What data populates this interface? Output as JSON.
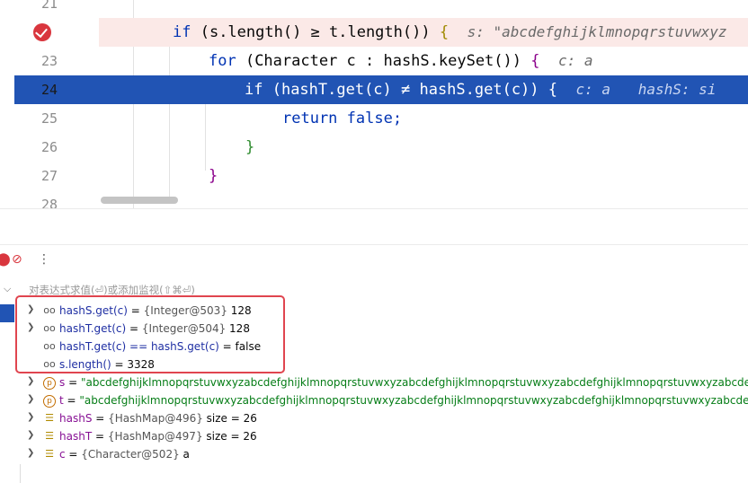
{
  "editor": {
    "line_numbers": [
      "21",
      "",
      "23",
      "24",
      "25",
      "26",
      "27",
      "28"
    ],
    "lines": [
      {
        "id": "l22",
        "kw": "if",
        "code": " (s.length() ≥ t.length()) ",
        "brace": "{",
        "hint": "s: \"abcdefghijklmnopqrstuvwxyz"
      },
      {
        "id": "l23",
        "kw": "for",
        "code": " (Character c : hashS.keySet()) ",
        "brace": "{",
        "hint": "c: a"
      },
      {
        "id": "l24",
        "kw": "if",
        "code": " (hashT.get(c) ≠ hashS.get(c)) {",
        "hint1": "c: a",
        "hint2": "hashS: si"
      },
      {
        "id": "l25",
        "kw": "return",
        "code": " false;"
      },
      {
        "id": "l26",
        "brace": "}"
      },
      {
        "id": "l27",
        "brace": "}"
      }
    ]
  },
  "toolbar": {
    "icons": [
      "breakpoint-icon",
      "mute-breakpoints-icon",
      "more-options-icon"
    ],
    "mute_glyph": "⊘",
    "more_glyph": "⋮"
  },
  "evaluate": {
    "placeholder": "对表达式求值(⏎)或添加监视(⇧⌘⏎)"
  },
  "variables": [
    {
      "kind": "watch",
      "expandable": true,
      "name": "hashS.get(c)",
      "eq": " = ",
      "type": "{Integer@503}",
      "value": " 128"
    },
    {
      "kind": "watch",
      "expandable": true,
      "name": "hashT.get(c)",
      "eq": " = ",
      "type": "{Integer@504}",
      "value": " 128"
    },
    {
      "kind": "watch",
      "expandable": false,
      "name": "hashT.get(c) == hashS.get(c)",
      "eq": " = ",
      "type": "",
      "value": "false"
    },
    {
      "kind": "watch",
      "expandable": false,
      "name": "s.length()",
      "eq": " = ",
      "type": "",
      "value": "3328"
    },
    {
      "kind": "param",
      "expandable": true,
      "name": "s",
      "eq": " = ",
      "type": "",
      "value": "\"abcdefghijklmnopqrstuvwxyzabcdefghijklmnopqrstuvwxyzabcdefghijklmnopqrstuvwxyzabcdefghijklmnopqrstuvwxyzabcdefghijklmnopqrstuvwxyzal"
    },
    {
      "kind": "param",
      "expandable": true,
      "name": "t",
      "eq": " = ",
      "type": "",
      "value": "\"abcdefghijklmnopqrstuvwxyzabcdefghijklmnopqrstuvwxyzabcdefghijklmnopqrstuvwxyzabcdefghijklmnopqrstuvwxyzabcdefghijklmnopqrstuvwxyzab"
    },
    {
      "kind": "field",
      "expandable": true,
      "name": "hashS",
      "eq": " = ",
      "type": "{HashMap@496}",
      "value": "  size = 26"
    },
    {
      "kind": "field",
      "expandable": true,
      "name": "hashT",
      "eq": " = ",
      "type": "{HashMap@497}",
      "value": "  size = 26"
    },
    {
      "kind": "field",
      "expandable": true,
      "name": "c",
      "eq": " = ",
      "type": "{Character@502}",
      "value": " a"
    }
  ],
  "colors": {
    "execution_line": "#2154b4",
    "breakpoint": "#d9363e",
    "highlight_box": "#e0454f"
  }
}
